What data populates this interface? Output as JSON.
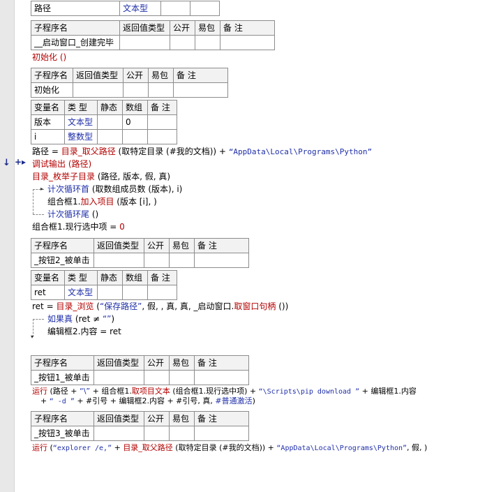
{
  "t0": {
    "name": "路径",
    "type": "文本型"
  },
  "hdr_sub": {
    "c1": "子程序名",
    "c2": "返回值类型",
    "c3": "公开",
    "c4": "易包",
    "c5": "备 注"
  },
  "hdr_var": {
    "c1": "变量名",
    "c2": "类 型",
    "c3": "静态",
    "c4": "数组",
    "c5": "备 注"
  },
  "sub1": {
    "name": "__启动窗口_创建完毕"
  },
  "call_init": "初始化 ()",
  "sub2": {
    "name": "初始化"
  },
  "vars2": [
    {
      "name": "版本",
      "type": "文本型",
      "array": "0"
    },
    {
      "name": "i",
      "type": "整数型",
      "array": ""
    }
  ],
  "code2": {
    "l1_a": "路径 = ",
    "l1_b": "目录_取父路径",
    "l1_c": " (取特定目录 (#我的文档)) + ",
    "l1_d": "“AppData\\Local\\Programs\\Python”",
    "l2": "调试输出 (路径)",
    "l3_a": "目录_枚举子目录",
    "l3_b": " (路径, 版本, 假, 真)",
    "l4_a": "计次循环首",
    "l4_b": " (取数组成员数 (版本), i)",
    "l5_a": "组合框1.",
    "l5_b": "加入项目",
    "l5_c": " (版本 [i], )",
    "l6_a": "计次循环尾",
    "l6_b": " ()",
    "l7_a": "组合框1.现行选中项 = ",
    "l7_b": "0"
  },
  "sub3": {
    "name": "_按钮2_被单击"
  },
  "vars3": [
    {
      "name": "ret",
      "type": "文本型"
    }
  ],
  "code3": {
    "l1_a": "ret = ",
    "l1_b": "目录_浏览",
    "l1_c": " (",
    "l1_d": "“保存路径”",
    "l1_e": ", 假, , 真, 真, _启动窗口.",
    "l1_f": "取窗口句柄",
    "l1_g": " ())",
    "l2_a": "如果真",
    "l2_b": " (ret ≠ ",
    "l2_c": "“”",
    "l2_d": ")",
    "l3": "编辑框2.内容 = ret"
  },
  "sub4": {
    "name": "_按钮1_被单击"
  },
  "code4": {
    "l1_a": "运行",
    "l1_b": " (路径 + ",
    "l1_c": "“\\”",
    "l1_d": " + 组合框1.",
    "l1_e": "取项目文本",
    "l1_f": " (组合框1.现行选中项) + ",
    "l1_g": "“\\Scripts\\pip download ”",
    "l1_h": " + 编辑框1.内容",
    "l2_a": "+ ",
    "l2_b": "“ -d ”",
    "l2_c": " + #引号 + 编辑框2.内容 + #引号, 真, ",
    "l2_d": "#普通激活",
    "l2_e": ")"
  },
  "sub5": {
    "name": "_按钮3_被单击"
  },
  "code5": {
    "l1_a": "运行",
    "l1_b": " (",
    "l1_c": "“explorer /e,”",
    "l1_d": " + ",
    "l1_e": "目录_取父路径",
    "l1_f": " (取特定目录 (#我的文档)) + ",
    "l1_g": "“AppData\\Local\\Programs\\Python”",
    "l1_h": ", 假, )"
  }
}
